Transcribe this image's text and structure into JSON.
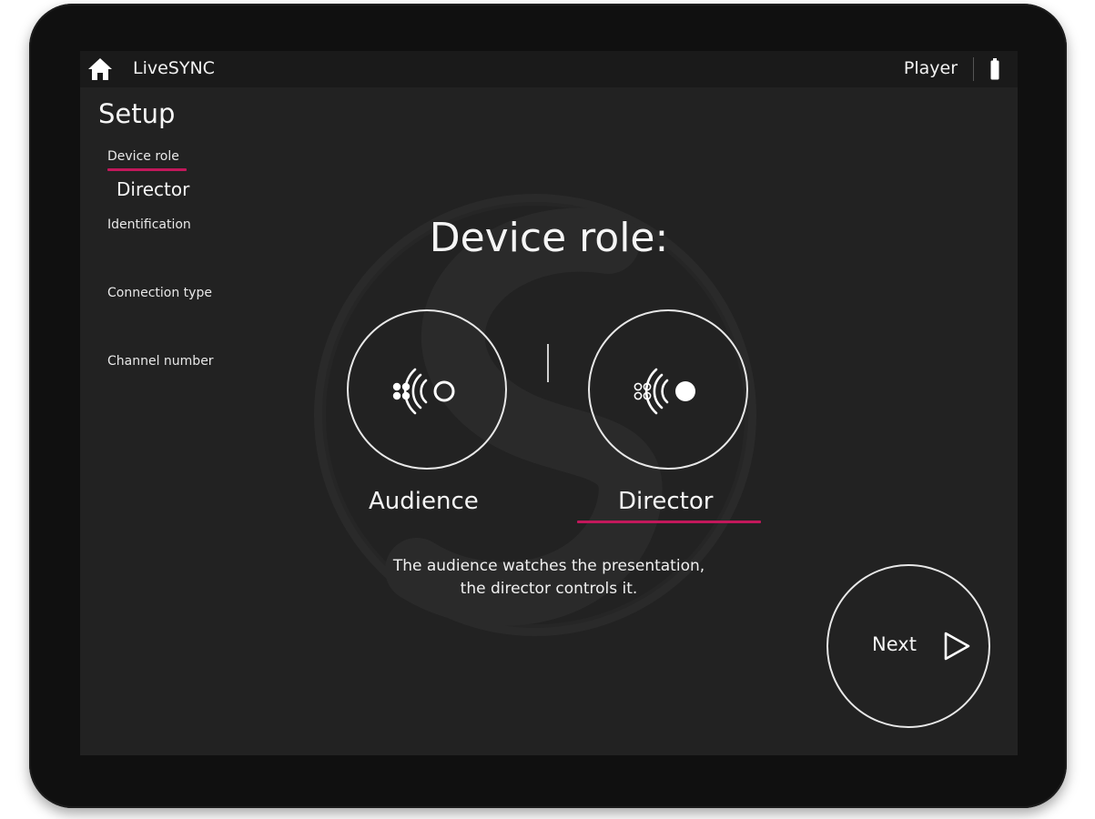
{
  "topbar": {
    "home_icon": "home-icon",
    "app_title": "LiveSYNC",
    "mode_label": "Player",
    "battery_icon": "battery-icon"
  },
  "sidebar": {
    "title": "Setup",
    "steps": [
      {
        "label": "Device role",
        "active": true,
        "value": "Director"
      },
      {
        "label": "Identification",
        "active": false
      },
      {
        "label": "Connection type",
        "active": false
      },
      {
        "label": "Channel number",
        "active": false
      }
    ]
  },
  "main": {
    "heading": "Device role:",
    "roles": [
      {
        "label": "Audience",
        "icon": "audience-broadcast-icon",
        "selected": false
      },
      {
        "label": "Director",
        "icon": "director-broadcast-icon",
        "selected": true
      }
    ],
    "description_line1": "The audience watches the presentation,",
    "description_line2": "the director controls it.",
    "next_label": "Next",
    "next_icon": "play-triangle-icon"
  },
  "colors": {
    "accent": "#c2185b",
    "screen_bg": "#222222",
    "topbar_bg": "#1a1a1a",
    "bezel": "#101010",
    "text": "#f5f5f5"
  }
}
